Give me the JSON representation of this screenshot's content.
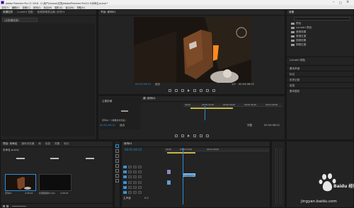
{
  "app": {
    "title": "Adobe Premiere Pro CC 2018 - C:\\用户\\Lenovo\\文档\\Adobe\\Premiere Pro\\12.0\\未命名.prproj *"
  },
  "menu": [
    "文件(F)",
    "编辑(E)",
    "剪辑(C)",
    "序列(S)",
    "标记(M)",
    "图形(G)",
    "窗口(W)",
    "帮助(H)"
  ],
  "source_panel": {
    "tabs": [
      "效果控件",
      "Lumetri 范围",
      "音频剪辑混合器: 序列01"
    ],
    "row_label": "(无剪辑选择)"
  },
  "program_panel": {
    "title": "节目: 序列01",
    "timecode_left": "00:01:04:12",
    "fit": "适合",
    "scale": "1/2",
    "timecode_right": "00:04:08:02"
  },
  "lower_monitor": {
    "title": "源: 序列01",
    "timecode_left": "00:01:04:12",
    "fit": "适合",
    "scale": "完整",
    "timecode_right": "00:04:08:02",
    "ruler_ticks": [
      "00:00",
      "00:00:15:00",
      "00:00:30:00",
      "00:00:45:00",
      "00:01:00:00"
    ],
    "label_a": "主要剪辑",
    "label_b": "序列01 * (效果的文件名)"
  },
  "effects_panel": {
    "title": "效果",
    "items": [
      "预设",
      "Lumetri 预设",
      "音频效果",
      "音频过渡",
      "视频效果",
      "视频过渡"
    ],
    "sections": [
      "Lumetri 颜色",
      "基本声音",
      "标记",
      "历史记录",
      "信息",
      "基本图形"
    ]
  },
  "project_panel": {
    "tabs": [
      "项目: 未命名",
      "媒体浏览器",
      "库",
      "信息",
      "效果",
      "标记"
    ],
    "file_name": "未命名.prproj",
    "items": [
      {
        "name": "序列01",
        "duration": "4:08:02"
      },
      {
        "name": "长视频素材.mp4",
        "duration": "4:08:02"
      }
    ]
  },
  "timeline": {
    "title": "序列01",
    "timecode": "00:01:04:12",
    "ruler_ticks": [
      "00:00",
      "00:00:15:00",
      "00:01:00:00"
    ],
    "video_tracks": [
      "V3",
      "V2",
      "V1"
    ],
    "audio_tracks": [
      "A1",
      "A2",
      "A3"
    ],
    "master": "主声道",
    "master_value": "0.0",
    "clip_label": "长视频素材.mp4 [V]"
  },
  "watermark": {
    "brand": "Baidu 经验",
    "url": "jingyan.baidu.com"
  },
  "colors": {
    "accent": "#2b8ed8",
    "bg": "#232323",
    "clip_video": "#8f86c9",
    "clip_audio": "#5e9ed6"
  }
}
